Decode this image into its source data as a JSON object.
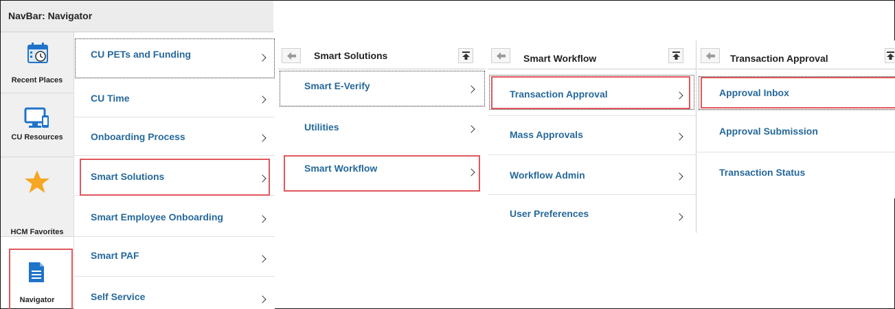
{
  "navbar": {
    "title": "NavBar: Navigator"
  },
  "rail": {
    "items": [
      {
        "label": "Recent Places",
        "icon": "calendar-clock-icon"
      },
      {
        "label": "CU Resources",
        "icon": "monitor-phone-icon"
      },
      {
        "label": "HCM Favorites",
        "icon": "star-icon"
      },
      {
        "label": "Navigator",
        "icon": "document-icon"
      }
    ]
  },
  "col1": {
    "items": [
      {
        "label": "CU PETs and Funding"
      },
      {
        "label": "CU Time"
      },
      {
        "label": "Onboarding Process"
      },
      {
        "label": "Smart Solutions"
      },
      {
        "label": "Smart Employee Onboarding"
      },
      {
        "label": "Smart PAF"
      },
      {
        "label": "Self Service"
      }
    ]
  },
  "col2": {
    "title": "Smart Solutions",
    "items": [
      {
        "label": "Smart E-Verify"
      },
      {
        "label": "Utilities"
      },
      {
        "label": "Smart Workflow"
      }
    ]
  },
  "col3": {
    "title": "Smart Workflow",
    "items": [
      {
        "label": "Transaction Approval"
      },
      {
        "label": "Mass Approvals"
      },
      {
        "label": "Workflow Admin"
      },
      {
        "label": "User Preferences"
      }
    ]
  },
  "col4": {
    "title": "Transaction Approval",
    "items": [
      {
        "label": "Approval Inbox"
      },
      {
        "label": "Approval Submission"
      },
      {
        "label": "Transaction Status"
      }
    ]
  },
  "colors": {
    "link": "#25689b",
    "highlight": "#e0565b",
    "icon_blue": "#1f73c9",
    "star": "#f5a623"
  }
}
